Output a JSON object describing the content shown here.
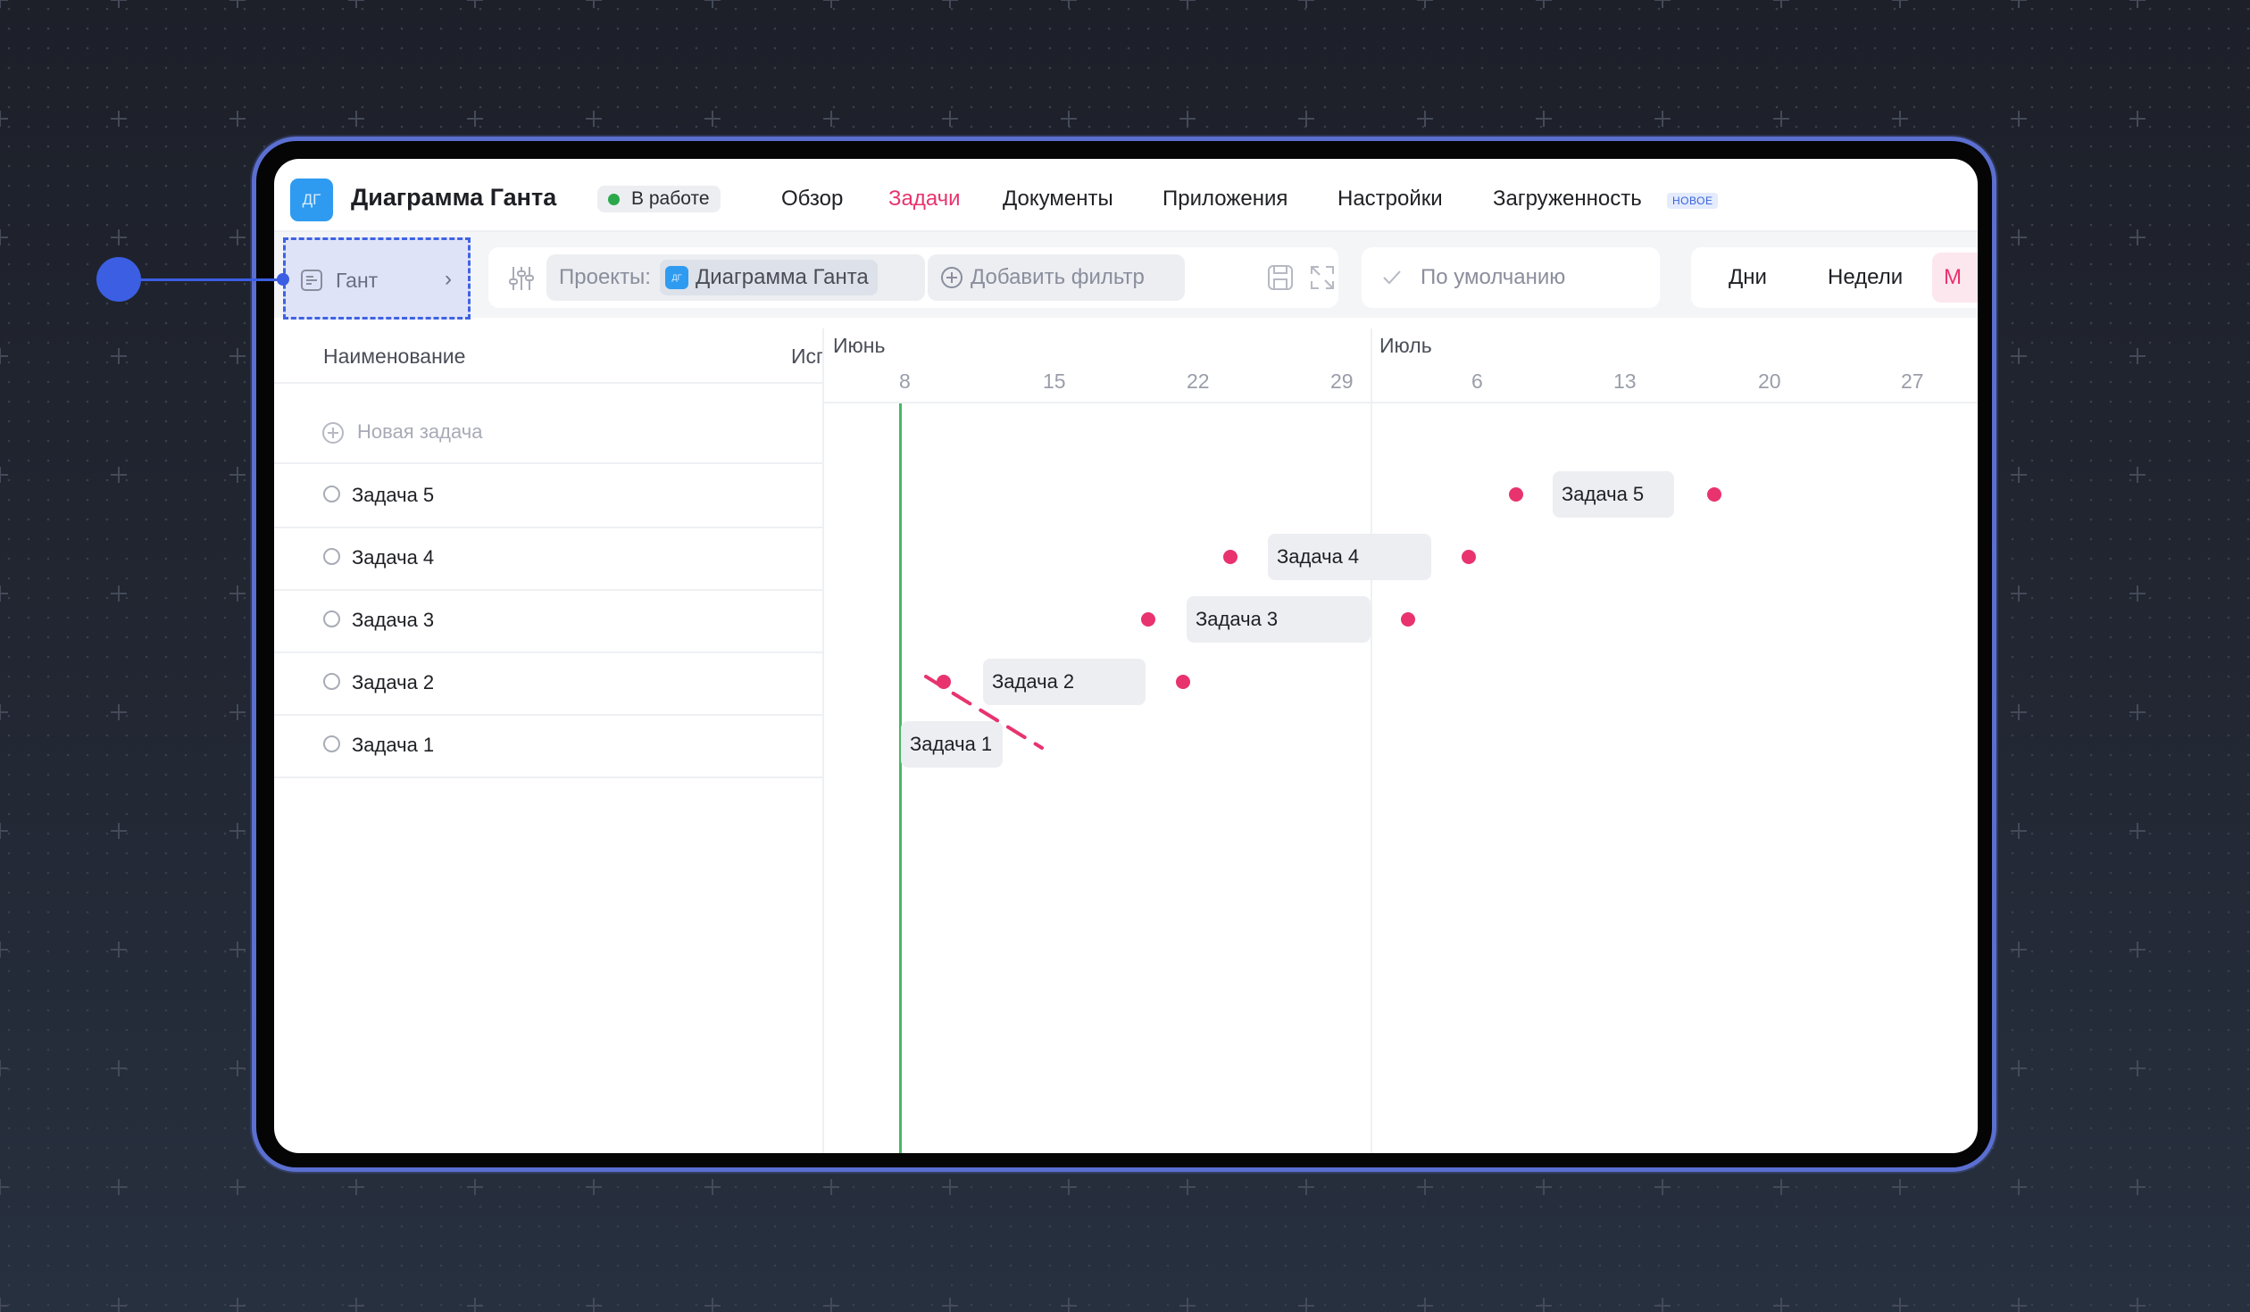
{
  "app": {
    "project_icon": "ДГ",
    "project_title": "Диаграмма Ганта",
    "status": {
      "label": "В работе",
      "color": "#2aa84a"
    },
    "nav": [
      {
        "label": "Обзор",
        "active": false
      },
      {
        "label": "Задачи",
        "active": true
      },
      {
        "label": "Документы",
        "active": false
      },
      {
        "label": "Приложения",
        "active": false
      },
      {
        "label": "Настройки",
        "active": false
      },
      {
        "label": "Загруженность",
        "active": false
      }
    ],
    "nav_badge": "НОВОЕ",
    "accent_color": "#e8336e"
  },
  "toolbar": {
    "view_tab": {
      "label": "Гант",
      "icon": "gantt-icon"
    },
    "filter_icon": "sliders-icon",
    "projects_label": "Проекты:",
    "projects_chip_icon": "ДГ",
    "projects_value": "Диаграмма Ганта",
    "add_filter_label": "Добавить фильтр",
    "save_icon": "save-icon",
    "expand_icon": "expand-icon",
    "sort_label": "По умолчанию",
    "scale": [
      "Дни",
      "Недели",
      "М"
    ]
  },
  "list": {
    "col_name": "Наименование",
    "col_assignee": "Исп",
    "new_task_label": "Новая задача",
    "tasks": [
      "Задача 5",
      "Задача 4",
      "Задача 3",
      "Задача 2",
      "Задача 1"
    ]
  },
  "timeline": {
    "months": [
      "Июнь",
      "Июль"
    ],
    "june_days": [
      "8",
      "15",
      "22",
      "29"
    ],
    "july_days": [
      "6",
      "13",
      "20",
      "27"
    ],
    "bars": [
      {
        "label": "Задача 5"
      },
      {
        "label": "Задача 4"
      },
      {
        "label": "Задача 3"
      },
      {
        "label": "Задача 2"
      },
      {
        "label": "Задача 1"
      }
    ],
    "today_color": "#48b864"
  }
}
